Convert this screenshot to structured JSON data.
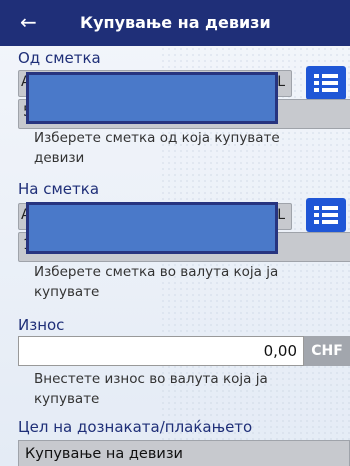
{
  "header": {
    "back_icon": "←",
    "title": "Купување на девизи"
  },
  "from_account": {
    "label": "Од сметка",
    "name_partial_left": "А",
    "name_partial_right": "KL",
    "number_partial": "5",
    "hint": "Изберете сметка од која купувате девизи",
    "list_icon": "list-icon"
  },
  "to_account": {
    "label": "На сметка",
    "name_partial_left": "А",
    "name_partial_right": "KL",
    "number_partial": "1",
    "hint": "Изберете сметка во валута која ја купувате",
    "list_icon": "list-icon"
  },
  "amount": {
    "label": "Износ",
    "value": "0,00",
    "currency": "CHF",
    "hint": "Внестете износ во валута која ја купувате"
  },
  "purpose": {
    "label": "Цел на дознаката/плаќањето",
    "value": "Купување на девизи"
  },
  "colors": {
    "header": "#1f2f78",
    "accent": "#1f56d6",
    "mask": "#4a79c9"
  }
}
